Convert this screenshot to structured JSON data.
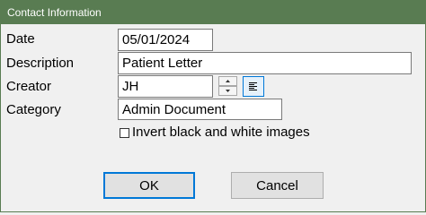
{
  "window": {
    "title": "Contact Information"
  },
  "form": {
    "date": {
      "label": "Date",
      "value": "05/01/2024"
    },
    "description": {
      "label": "Description",
      "value": "Patient Letter"
    },
    "creator": {
      "label": "Creator",
      "value": "JH"
    },
    "category": {
      "label": "Category",
      "value": "Admin Document"
    },
    "invert": {
      "label": "Invert black and white images",
      "checked": false
    }
  },
  "buttons": {
    "ok": "OK",
    "cancel": "Cancel"
  },
  "icons": {
    "spin_up": "triangle-up-icon",
    "spin_down": "triangle-down-icon",
    "align": "align-left-icon"
  },
  "colors": {
    "titlebar": "#597c52",
    "focus": "#0078d7"
  }
}
